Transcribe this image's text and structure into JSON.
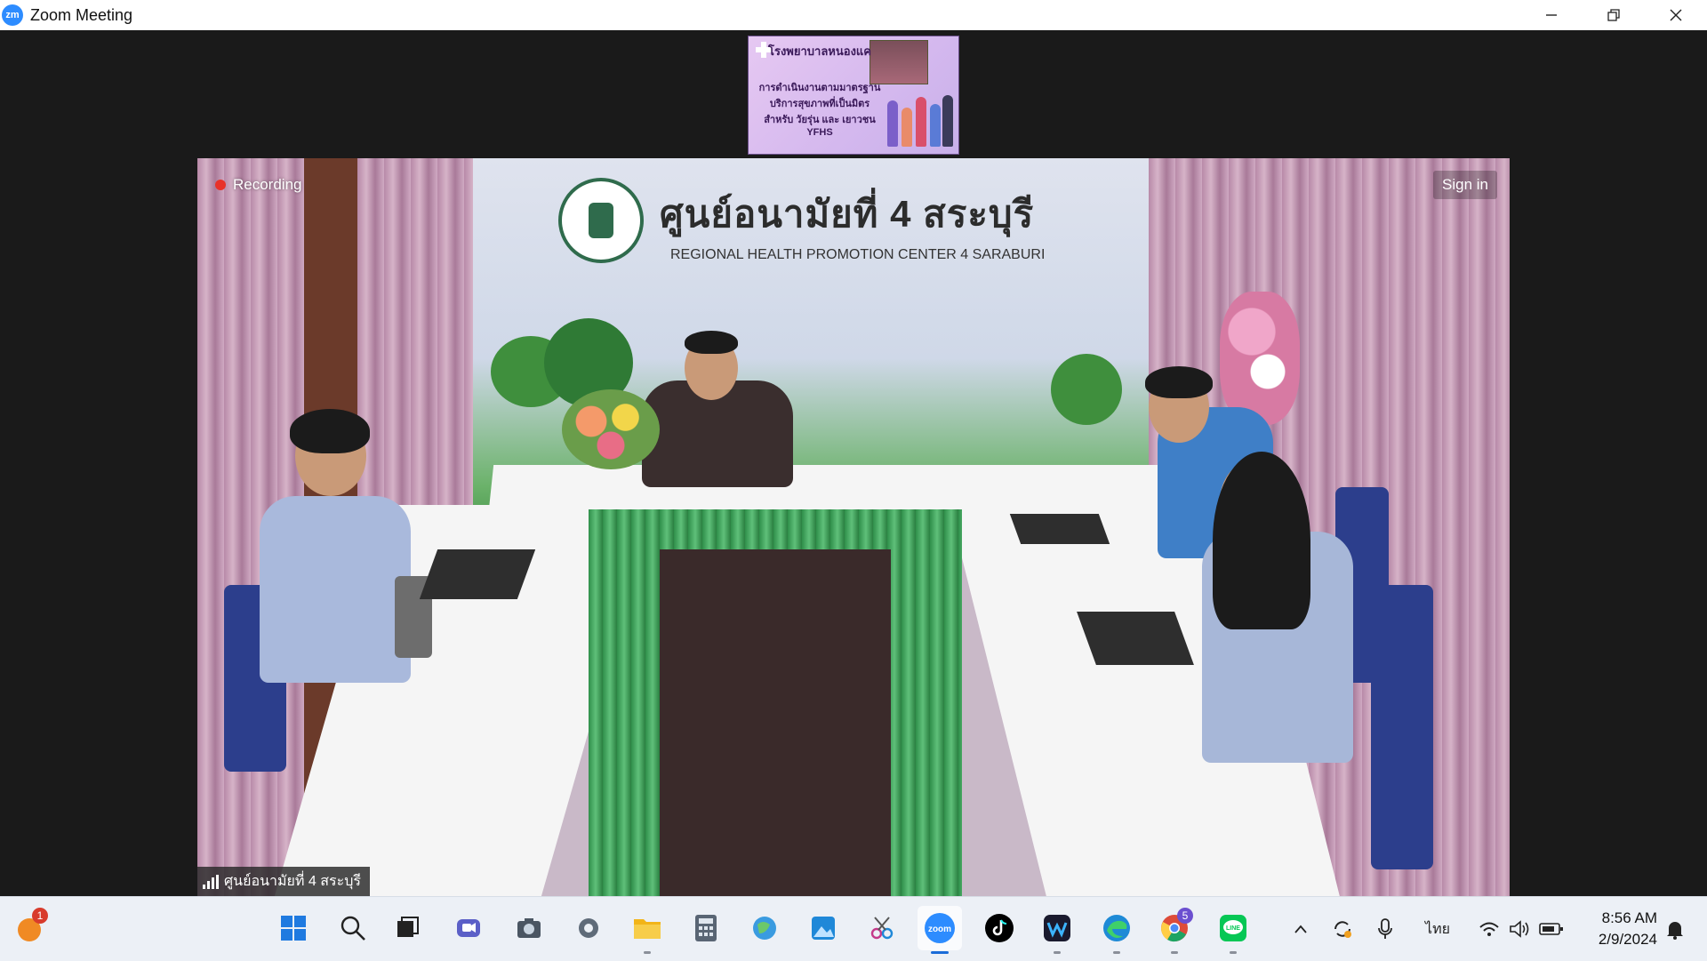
{
  "window": {
    "app_icon_text": "zm",
    "title": "Zoom Meeting",
    "controls": [
      "minimize-icon",
      "restore-icon",
      "close-icon"
    ]
  },
  "thumbnail": {
    "hospital_name": "โรงพยาบาลหนองแค",
    "lines": [
      "การดำเนินงานตามมาตรฐาน",
      "บริการสุขภาพที่เป็นมิตร",
      "สำหรับ วัยรุ่น และ เยาวชน",
      "YFHS"
    ]
  },
  "video": {
    "recording_label": "Recording",
    "signin_label": "Sign in",
    "participant_name": "ศูนย์อนามัยที่ 4 สระบุรี",
    "backdrop_title": "ศูนย์อนามัยที่ 4 สระบุรี",
    "backdrop_subtitle": "REGIONAL HEALTH PROMOTION CENTER 4 SARABURI"
  },
  "taskbar": {
    "notification_badge": "1",
    "chrome_badge": "5",
    "apps": [
      {
        "name": "start-icon",
        "color": "#1f7ae0"
      },
      {
        "name": "search-icon",
        "color": "#222222"
      },
      {
        "name": "task-view-icon",
        "color": "#222222"
      },
      {
        "name": "meet-icon",
        "color": "#5b5fc7"
      },
      {
        "name": "camera-icon",
        "color": "#4a5562"
      },
      {
        "name": "settings-icon",
        "color": "#5f6b79"
      },
      {
        "name": "file-explorer-icon",
        "color": "#f2b418"
      },
      {
        "name": "calculator-icon",
        "color": "#596574"
      },
      {
        "name": "maps-icon",
        "color": "#3a9be0"
      },
      {
        "name": "photos-icon",
        "color": "#1f88d8"
      },
      {
        "name": "snipping-tool-icon",
        "color": "#c43a8a"
      },
      {
        "name": "zoom-icon",
        "color": "#2d8cff"
      },
      {
        "name": "tiktok-icon",
        "color": "#000000"
      },
      {
        "name": "webex-icon",
        "color": "#1a1a2e"
      },
      {
        "name": "edge-icon",
        "color": "#1e8ad6"
      },
      {
        "name": "chrome-icon",
        "color": "#dd4b39"
      },
      {
        "name": "line-icon",
        "color": "#06c755"
      }
    ],
    "language": "ไทย",
    "time": "8:56 AM",
    "date": "2/9/2024"
  }
}
